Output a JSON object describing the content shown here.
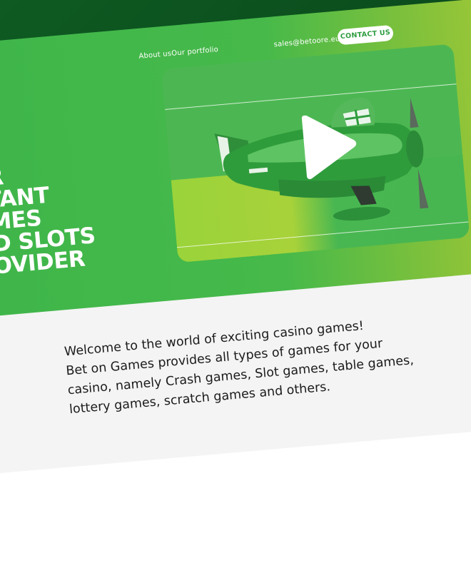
{
  "nav": {
    "about": "About us",
    "portfolio": "Our portfolio",
    "email": "sales@betoore.eu",
    "contact": "CONTACT US"
  },
  "hero": {
    "headline": [
      "UR",
      "STANT",
      "AMES",
      "ND SLOTS",
      "ROVIDER"
    ]
  },
  "video": {
    "play_icon": "play-icon"
  },
  "intro": {
    "lines": [
      "Welcome to the world of exciting casino games!",
      "Bet on Games provides all types of games for your",
      "casino, namely Crash games, Slot games, table games,",
      "lottery games, scratch games and others."
    ]
  },
  "colors": {
    "brand_green": "#46b94a",
    "accent_lime": "#a6c935",
    "dark_bg": "#0b4a1c",
    "content_bg": "#f4f4f4"
  }
}
